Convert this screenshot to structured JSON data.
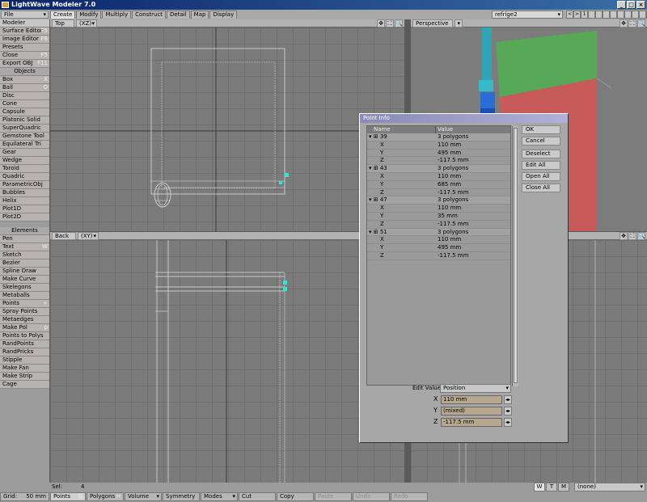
{
  "app": {
    "title": "LightWave Modeler 7.0"
  },
  "menubar": {
    "file_label": "File",
    "tabs": [
      "Create",
      "Modify",
      "Multiply",
      "Construct",
      "Detail",
      "Map",
      "Display"
    ],
    "active_tab": "Create",
    "object_name": "refrige2",
    "layers": [
      "<",
      ">",
      "1"
    ]
  },
  "sidebar": {
    "top_items": [
      {
        "label": "Modeler",
        "key": ""
      },
      {
        "label": "Surface Editor",
        "key": "F5"
      },
      {
        "label": "Image Editor",
        "key": "F6"
      },
      {
        "label": "Presets",
        "key": ""
      },
      {
        "label": "Close",
        "key": "F5"
      },
      {
        "label": "Export OBJ",
        "key": "F11"
      }
    ],
    "objects_header": "Objects",
    "objects": [
      {
        "label": "Box",
        "key": "X"
      },
      {
        "label": "Ball",
        "key": "O"
      },
      {
        "label": "Disc",
        "key": ""
      },
      {
        "label": "Cone",
        "key": ""
      },
      {
        "label": "Capsule",
        "key": ""
      },
      {
        "label": "Platonic Solid",
        "key": ""
      },
      {
        "label": "SuperQuadric",
        "key": ""
      },
      {
        "label": "Gemstone Tool",
        "key": ""
      },
      {
        "label": "Equilateral Tri",
        "key": ""
      },
      {
        "label": "Gear",
        "key": ""
      },
      {
        "label": "Wedge",
        "key": ""
      },
      {
        "label": "Toroid",
        "key": ""
      },
      {
        "label": "Quadric",
        "key": ""
      },
      {
        "label": "ParametricObj",
        "key": ""
      },
      {
        "label": "Bubbles",
        "key": ""
      },
      {
        "label": "Helix",
        "key": ""
      },
      {
        "label": "Plot1D",
        "key": ""
      },
      {
        "label": "Plot2D",
        "key": ""
      }
    ],
    "elements_header": "Elements",
    "elements": [
      {
        "label": "Pen",
        "key": ""
      },
      {
        "label": "Text",
        "key": "W"
      },
      {
        "label": "Sketch",
        "key": ""
      },
      {
        "label": "Bezier",
        "key": ""
      },
      {
        "label": "Spline Draw",
        "key": ""
      },
      {
        "label": "Make Curve",
        "key": ""
      },
      {
        "label": "Skelegons",
        "key": ""
      },
      {
        "label": "Metaballs",
        "key": ""
      },
      {
        "label": "Points",
        "key": "+"
      },
      {
        "label": "Spray Points",
        "key": ""
      },
      {
        "label": "Metaedges",
        "key": ""
      },
      {
        "label": "Make Pol",
        "key": "p"
      },
      {
        "label": "Points to Polys",
        "key": ""
      },
      {
        "label": "RandPoints",
        "key": ""
      },
      {
        "label": "RandPricks",
        "key": ""
      },
      {
        "label": "Stipple",
        "key": ""
      },
      {
        "label": "Make Fan",
        "key": ""
      },
      {
        "label": "Make Strip",
        "key": ""
      },
      {
        "label": "Cage",
        "key": ""
      }
    ]
  },
  "viewports": {
    "top_left": {
      "view": "Top",
      "axes": "(XZ)"
    },
    "top_right": {
      "view": "Perspective"
    },
    "bottom_left": {
      "view": "Back",
      "axes": "(XY)"
    },
    "icons": [
      "✥",
      "⛶",
      "🔍"
    ]
  },
  "dialog": {
    "title": "Point Info",
    "col_name": "Name",
    "col_value": "Value",
    "rows": [
      {
        "kind": "parent",
        "name": "▾ ⊞ 39",
        "value": "3 polygons"
      },
      {
        "kind": "child",
        "name": "X",
        "value": "110 mm"
      },
      {
        "kind": "child",
        "name": "Y",
        "value": "495 mm"
      },
      {
        "kind": "child",
        "name": "Z",
        "value": "-117.5 mm"
      },
      {
        "kind": "parent",
        "name": "▾ ⊞ 43",
        "value": "3 polygons"
      },
      {
        "kind": "child",
        "name": "X",
        "value": "110 mm"
      },
      {
        "kind": "child",
        "name": "Y",
        "value": "685 mm"
      },
      {
        "kind": "child",
        "name": "Z",
        "value": "-117.5 mm"
      },
      {
        "kind": "parent",
        "name": "▾ ⊞ 47",
        "value": "3 polygons"
      },
      {
        "kind": "child",
        "name": "X",
        "value": "110 mm"
      },
      {
        "kind": "child",
        "name": "Y",
        "value": "35 mm"
      },
      {
        "kind": "child",
        "name": "Z",
        "value": "-117.5 mm"
      },
      {
        "kind": "parent",
        "name": "▾ ⊞ 51",
        "value": "3 polygons"
      },
      {
        "kind": "child",
        "name": "X",
        "value": "110 mm"
      },
      {
        "kind": "child",
        "name": "Y",
        "value": "495 mm"
      },
      {
        "kind": "child",
        "name": "Z",
        "value": "-117.5 mm"
      }
    ],
    "buttons": {
      "ok": "OK",
      "cancel": "Cancel",
      "deselect": "Deselect",
      "edit_all": "Edit All",
      "open_all": "Open All",
      "close_all": "Close All"
    },
    "edit_value_label": "Edit Value",
    "edit_value_option": "Position",
    "x_label": "X",
    "x_value": "110 mm",
    "y_label": "Y",
    "y_value": "(mixed)",
    "z_label": "Z",
    "z_value": "-117.5 mm"
  },
  "status": {
    "sel_label": "Sel:",
    "sel_count": "4",
    "grid_label": "Grid:",
    "grid_value": "50 mm",
    "points": "Points",
    "points_key": "G",
    "polygons": "Polygons",
    "polygons_key": "H",
    "volume": "Volume",
    "symmetry": "Symmetry",
    "modes": "Modes",
    "cut": "Cut",
    "copy": "Copy",
    "paste": "Paste",
    "undo": "Undo",
    "redo": "Redo",
    "wtm": [
      "W",
      "T",
      "M"
    ],
    "surface": "(none)"
  }
}
